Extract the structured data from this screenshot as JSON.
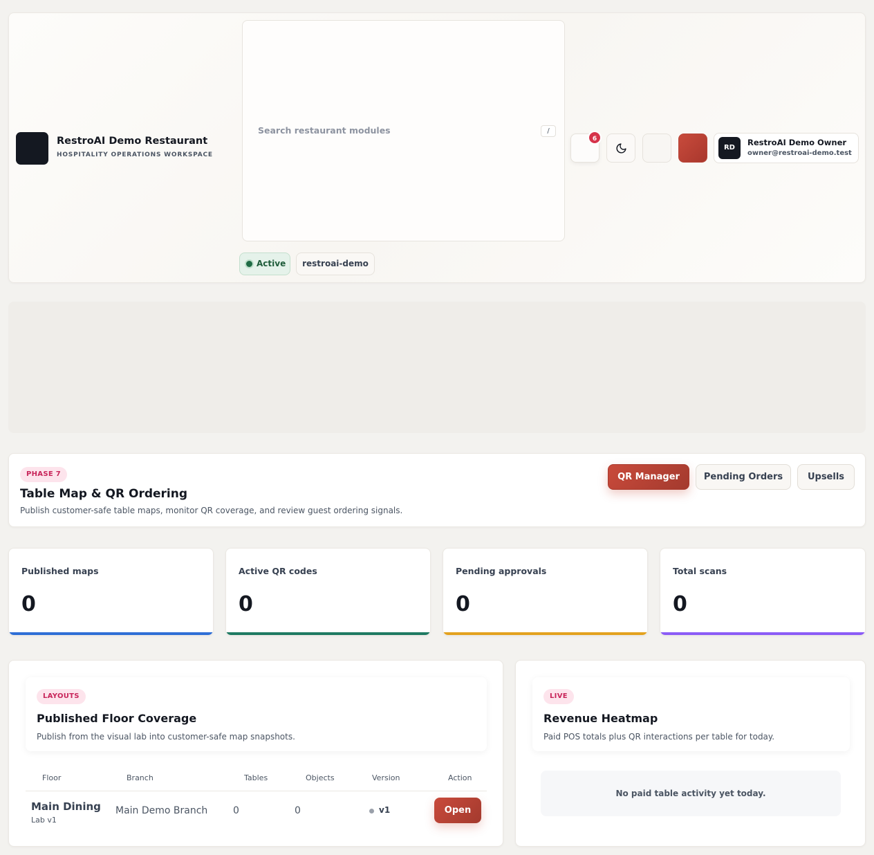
{
  "header": {
    "brand_title": "RestroAI Demo Restaurant",
    "brand_subtitle": "HOSPITALITY OPERATIONS WORKSPACE",
    "search_placeholder": "Search restaurant modules",
    "search_shortcut": "/",
    "status_label": "Active",
    "workspace_slug": "restroai-demo",
    "notification_count": "6",
    "accent_color": "#c84b3c",
    "user": {
      "initials": "RD",
      "name": "RestroAI Demo Owner",
      "email": "owner@restroai-demo.test"
    }
  },
  "hero": {
    "phase_label": "PHASE 7",
    "title": "Table Map & QR Ordering",
    "description": "Publish customer-safe table maps, monitor QR coverage, and review guest ordering signals.",
    "actions": [
      "QR Manager",
      "Pending Orders",
      "Upsells"
    ]
  },
  "stats": [
    {
      "label": "Published maps",
      "value": "0",
      "color": "#2f6fd6"
    },
    {
      "label": "Active QR codes",
      "value": "0",
      "color": "#1f7a63"
    },
    {
      "label": "Pending approvals",
      "value": "0",
      "color": "#e3a21f"
    },
    {
      "label": "Total scans",
      "value": "0",
      "color": "#8b5cf6"
    }
  ],
  "floor_coverage": {
    "tag": "LAYOUTS",
    "title": "Published Floor Coverage",
    "description": "Publish from the visual lab into customer-safe map snapshots.",
    "columns": [
      "Floor",
      "Branch",
      "Tables",
      "Objects",
      "Version",
      "Action"
    ],
    "rows": [
      {
        "floor": "Main Dining",
        "floor_sub": "Lab v1",
        "branch": "Main Demo Branch",
        "tables": "0",
        "objects": "0",
        "version": "v1",
        "action": "Open"
      }
    ]
  },
  "heatmap": {
    "tag": "LIVE",
    "title": "Revenue Heatmap",
    "description": "Paid POS totals plus QR interactions per table for today.",
    "empty_message": "No paid table activity yet today."
  }
}
